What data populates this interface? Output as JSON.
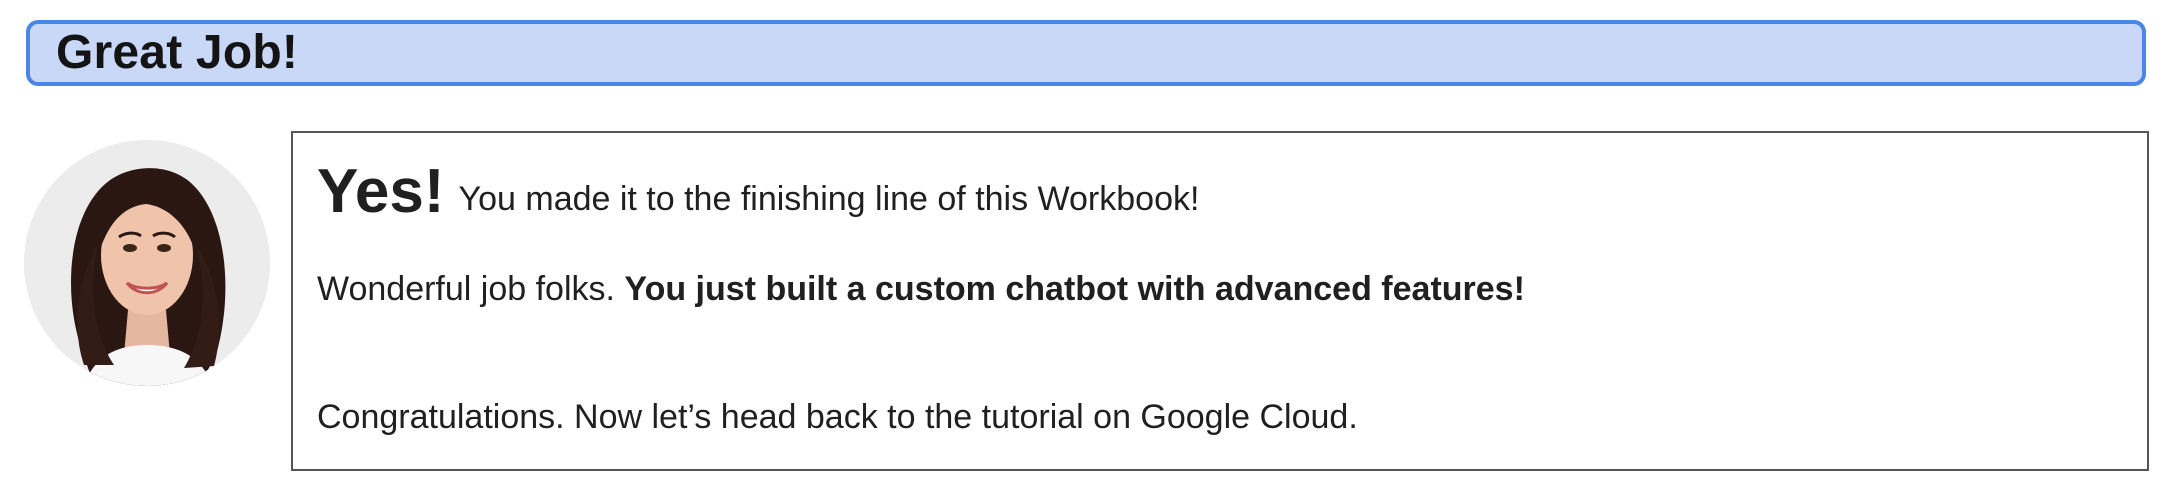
{
  "header": {
    "title": "Great Job!"
  },
  "avatar": {
    "description_icon": "person-photo"
  },
  "message": {
    "line1_emphasis": "Yes!",
    "line1_text": "You made it to the finishing line of this Workbook!",
    "line2_text": "Wonderful job folks. ",
    "line2_bold": "You just built a custom chatbot with advanced features!",
    "line3_text": "Congratulations. Now let’s head back to the tutorial on Google Cloud."
  },
  "colors": {
    "banner_fill": "#c9d8f6",
    "banner_border": "#4a86e8",
    "box_border": "#555555",
    "text": "#202020"
  }
}
